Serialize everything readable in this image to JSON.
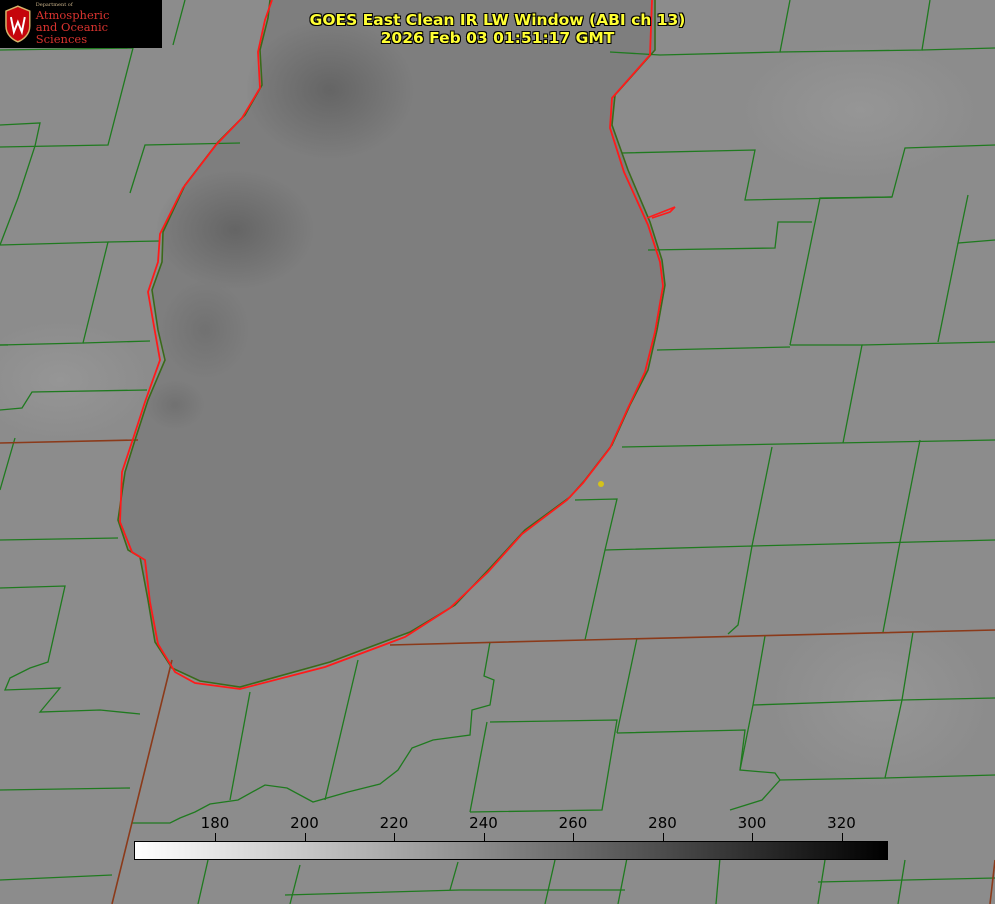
{
  "header": {
    "title_line1": "GOES East Clean IR LW Window (ABI ch 13)",
    "title_line2": "2026 Feb 03 01:51:17 GMT"
  },
  "logo": {
    "dept": "Department of",
    "line1": "Atmospheric",
    "line2": "and Oceanic Sciences"
  },
  "colorbar": {
    "ticks": [
      "180",
      "200",
      "220",
      "240",
      "260",
      "280",
      "300",
      "320"
    ]
  },
  "colors": {
    "title": "#ffff33",
    "county_lines": "#1f7a1f",
    "state_lines": "#8b3a1a",
    "lake_outline": "#ff1a1a",
    "marker": "#d4c21a"
  }
}
